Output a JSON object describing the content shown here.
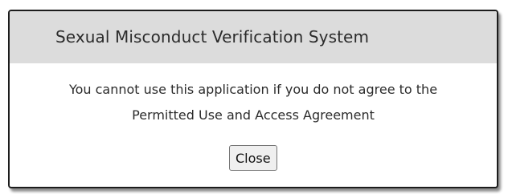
{
  "dialog": {
    "title": "Sexual Misconduct Verification System",
    "message_line_1": "You cannot use this application if you do not agree to the",
    "message_line_2": "Permitted Use and Access Agreement",
    "close_label": "Close"
  }
}
